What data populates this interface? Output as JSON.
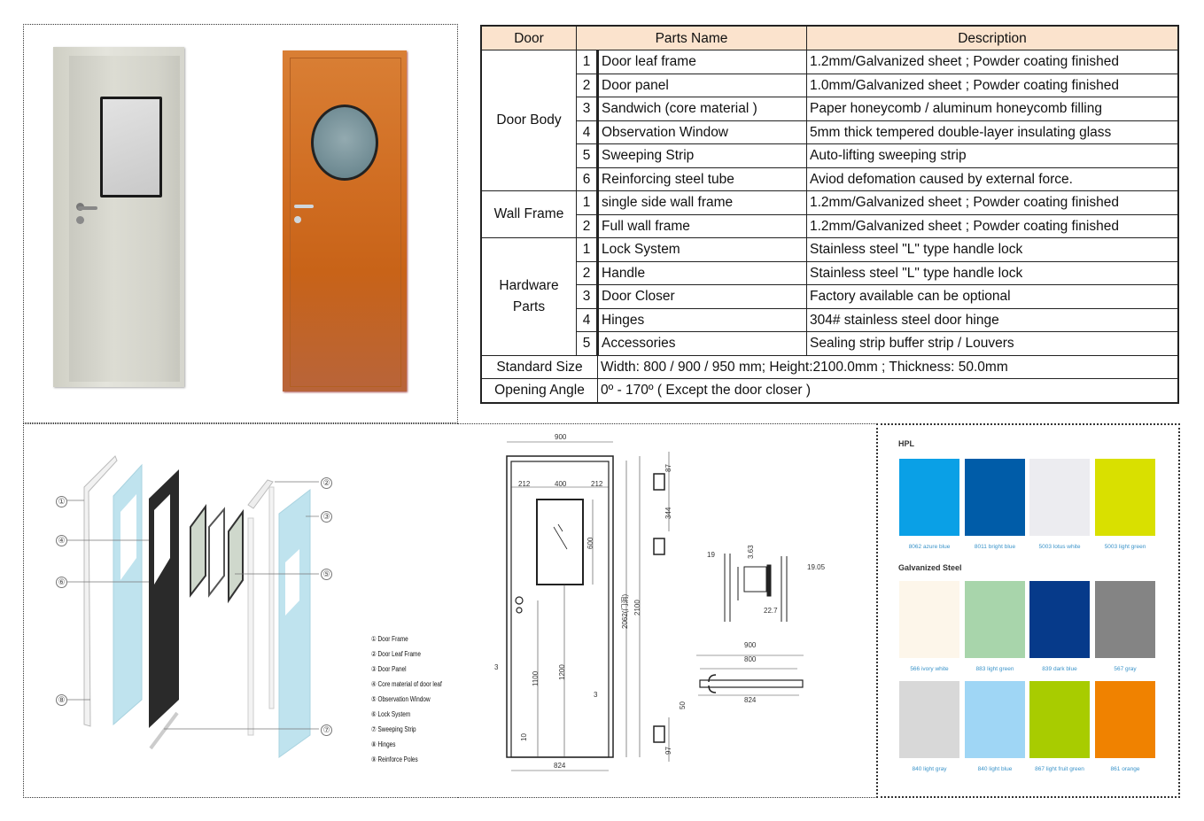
{
  "spec_table": {
    "headers": [
      "Door",
      "Parts Name",
      "Description"
    ],
    "groups": [
      {
        "name": "Door Body",
        "rows": [
          {
            "no": "1",
            "part": "Door leaf frame",
            "desc": "1.2mm/Galvanized sheet ; Powder coating finished"
          },
          {
            "no": "2",
            "part": "Door panel",
            "desc": "1.0mm/Galvanized sheet ; Powder coating finished"
          },
          {
            "no": "3",
            "part": "Sandwich (core material )",
            "desc": "Paper honeycomb / aluminum honeycomb filling"
          },
          {
            "no": "4",
            "part": "Observation Window",
            "desc": "5mm thick tempered double-layer insulating glass"
          },
          {
            "no": "5",
            "part": "Sweeping Strip",
            "desc": "Auto-lifting sweeping strip"
          },
          {
            "no": "6",
            "part": "Reinforcing steel tube",
            "desc": "Aviod defomation caused by external force."
          }
        ]
      },
      {
        "name": "Wall Frame",
        "rows": [
          {
            "no": "1",
            "part": "single side wall frame",
            "desc": "1.2mm/Galvanized sheet ; Powder coating finished"
          },
          {
            "no": "2",
            "part": "Full wall frame",
            "desc": "1.2mm/Galvanized sheet ; Powder coating finished"
          }
        ]
      },
      {
        "name": "Hardware Parts",
        "rows": [
          {
            "no": "1",
            "part": "Lock System",
            "desc": "Stainless steel \"L\" type handle lock"
          },
          {
            "no": "2",
            "part": "Handle",
            "desc": "Stainless steel \"L\" type handle lock"
          },
          {
            "no": "3",
            "part": "Door Closer",
            "desc": "Factory available can be optional"
          },
          {
            "no": "4",
            "part": "Hinges",
            "desc": "304# stainless steel door hinge"
          },
          {
            "no": "5",
            "part": "Accessories",
            "desc": "Sealing strip buffer strip  /   Louvers"
          }
        ]
      }
    ],
    "standard_size": {
      "label": "Standard Size",
      "value": "Width: 800  /  900  / 950 mm;   Height:2100.0mm ;     Thickness: 50.0mm"
    },
    "opening_angle": {
      "label": "Opening Angle",
      "value": "0º - 170º ( Except the door closer )"
    }
  },
  "exploded": {
    "callouts": [
      "①",
      "②",
      "③",
      "④",
      "⑤",
      "⑥",
      "⑦",
      "⑧"
    ],
    "legend": [
      "① Door Frame",
      "② Door Leaf Frame",
      "③ Door Panel",
      "④ Core material of door leaf",
      "⑤ Observation Window",
      "⑥ Lock System",
      "⑦ Sweeping Strip",
      "⑧ Hinges",
      "⑨ Reinforce Poles"
    ]
  },
  "drawing": {
    "front": {
      "width": "900",
      "left": "212",
      "window": "400",
      "right": "212",
      "window_h": "600",
      "h_inner": "2062(门洞)",
      "h_total": "2100",
      "handle_h": "1100",
      "window_bottom": "1200",
      "gap_left": "3",
      "gap_right": "3",
      "bottom": "10",
      "leaf_width": "824"
    },
    "hinge": {
      "top": "87",
      "spacing": "344",
      "bottom": "97"
    },
    "lock": {
      "a": "19",
      "b": "3.63",
      "c": "22.7",
      "d": "19.05"
    },
    "plan": {
      "outer": "900",
      "inner": "800",
      "leaf": "824",
      "thickness": "50"
    }
  },
  "colors": {
    "hpl_title": "HPL",
    "hpl": [
      {
        "name": "8062 azure blue",
        "hex": "#0aa0e6"
      },
      {
        "name": "8011 bright blue",
        "hex": "#005ca8"
      },
      {
        "name": "5003 lotus white",
        "hex": "#ececf0"
      },
      {
        "name": "5003 light green",
        "hex": "#d9e000"
      }
    ],
    "steel_title": "Galvanized Steel",
    "steel": [
      {
        "name": "566 ivory white",
        "hex": "#fdf6ea"
      },
      {
        "name": "883 light green",
        "hex": "#a8d5ab"
      },
      {
        "name": "839 dark blue",
        "hex": "#063a8a"
      },
      {
        "name": "567 gray",
        "hex": "#848484"
      },
      {
        "name": "840 light gray",
        "hex": "#d8d8d8"
      },
      {
        "name": "840 light blue",
        "hex": "#9fd6f5"
      },
      {
        "name": "867 light fruit green",
        "hex": "#a8cc00"
      },
      {
        "name": "861 orange",
        "hex": "#f08200"
      }
    ]
  }
}
